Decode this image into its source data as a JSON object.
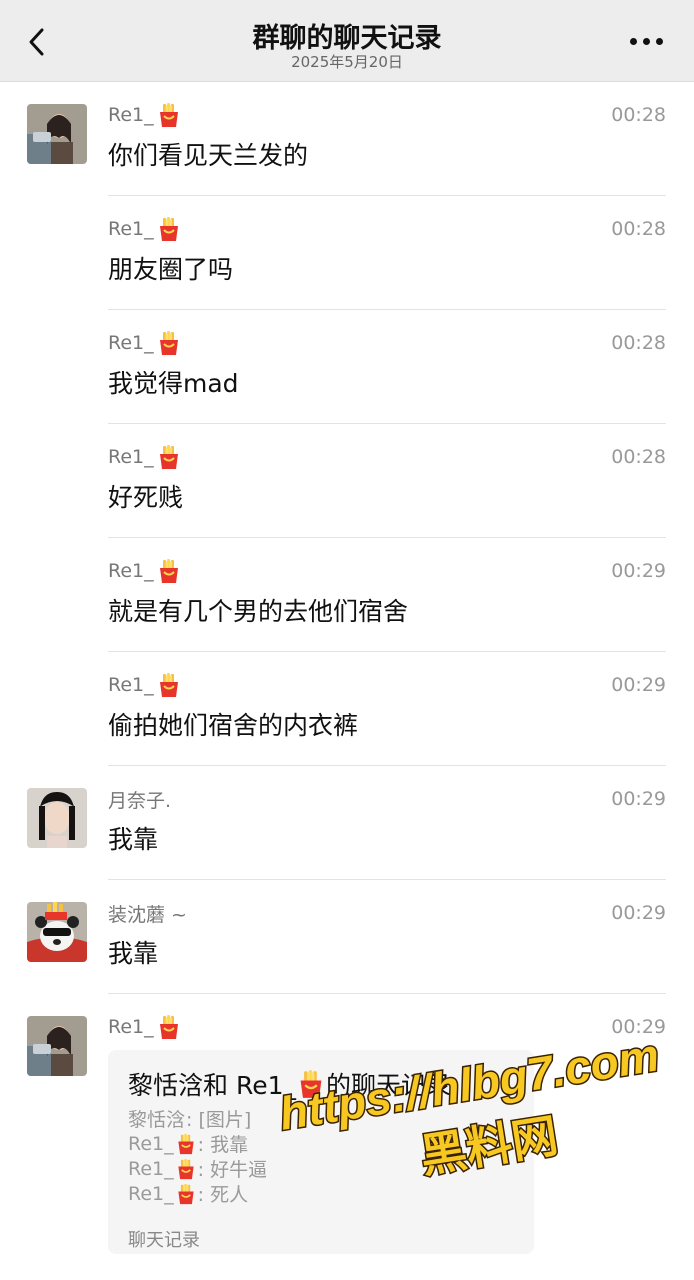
{
  "header": {
    "title": "群聊的聊天记录",
    "subtitle": "2025年5月20日",
    "back_icon": "chevron-left-icon",
    "more_icon": "more-dots-icon"
  },
  "colors": {
    "header_bg": "#ededed",
    "watermark_fill": "#f7c821",
    "watermark_stroke": "#3a2200"
  },
  "messages": [
    {
      "sender": "Re1_",
      "sender_icon": "fries-icon",
      "time": "00:28",
      "text": "你们看见天兰发的",
      "avatar": "avatar-girl-selfie"
    },
    {
      "sender": "Re1_",
      "sender_icon": "fries-icon",
      "time": "00:28",
      "text": "朋友圈了吗"
    },
    {
      "sender": "Re1_",
      "sender_icon": "fries-icon",
      "time": "00:28",
      "text": "我觉得mad"
    },
    {
      "sender": "Re1_",
      "sender_icon": "fries-icon",
      "time": "00:28",
      "text": "好死贱"
    },
    {
      "sender": "Re1_",
      "sender_icon": "fries-icon",
      "time": "00:29",
      "text": "就是有几个男的去他们宿舍"
    },
    {
      "sender": "Re1_",
      "sender_icon": "fries-icon",
      "time": "00:29",
      "text": "偷拍她们宿舍的内衣裤"
    },
    {
      "sender": "月奈子.",
      "time": "00:29",
      "text": "我靠",
      "avatar": "avatar-girl-portrait"
    },
    {
      "sender": "装沈蘑 ~",
      "time": "00:29",
      "text": "我靠",
      "avatar": "avatar-panda-fries"
    },
    {
      "sender": "Re1_",
      "sender_icon": "fries-icon",
      "time": "00:29",
      "avatar": "avatar-girl-selfie",
      "card": {
        "title_prefix": "黎恬浛和 Re1_",
        "title_suffix": "的聊天记录",
        "lines": [
          {
            "name": "黎恬浛",
            "text": ": [图片]"
          },
          {
            "name": "Re1_",
            "text": ": 我靠"
          },
          {
            "name": "Re1_",
            "text": ": 好牛逼"
          },
          {
            "name": "Re1_",
            "text": ": 死人"
          }
        ],
        "footer": "聊天记录"
      }
    }
  ],
  "watermark": {
    "url": "https://hlbg7.com",
    "label": "黑料网"
  }
}
